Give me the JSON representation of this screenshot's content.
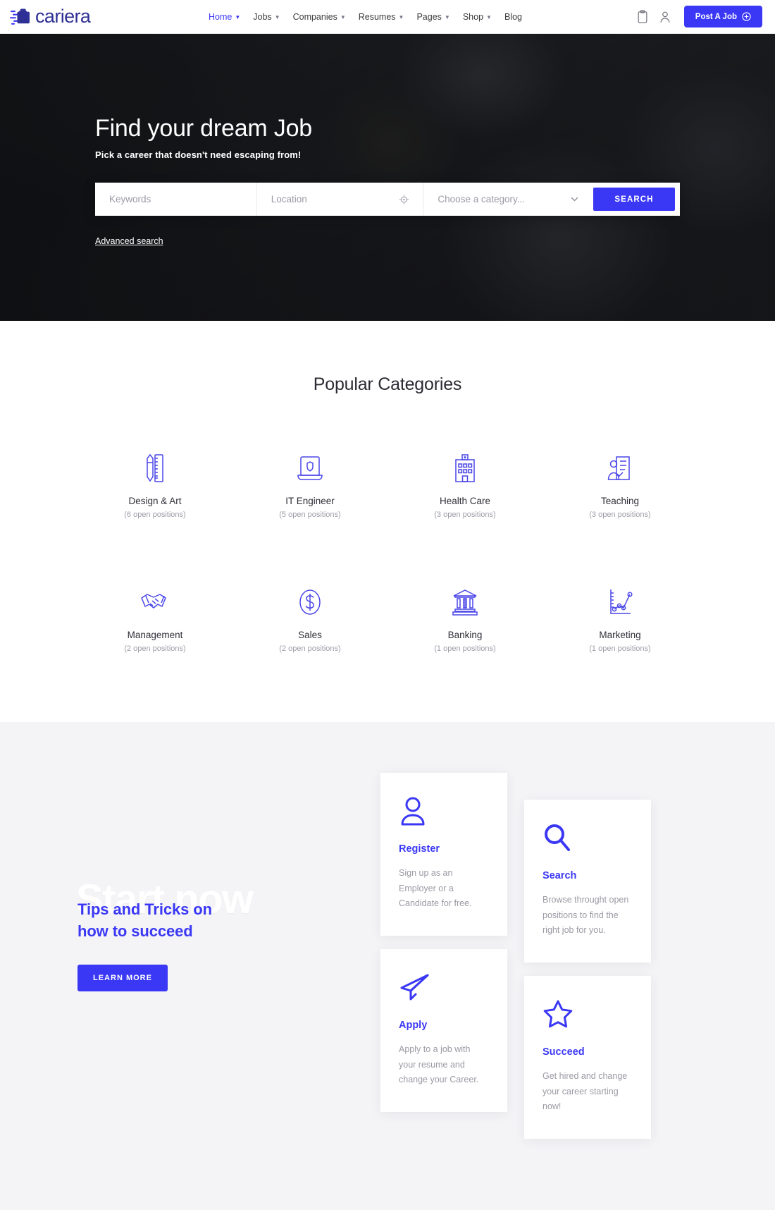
{
  "header": {
    "logo_text": "cariera",
    "logo_icon": "briefcase-speed-icon",
    "nav": [
      {
        "label": "Home",
        "has_caret": true,
        "active": true
      },
      {
        "label": "Jobs",
        "has_caret": true,
        "active": false
      },
      {
        "label": "Companies",
        "has_caret": true,
        "active": false
      },
      {
        "label": "Resumes",
        "has_caret": true,
        "active": false
      },
      {
        "label": "Pages",
        "has_caret": true,
        "active": false
      },
      {
        "label": "Shop",
        "has_caret": true,
        "active": false
      },
      {
        "label": "Blog",
        "has_caret": false,
        "active": false
      }
    ],
    "bookmark_icon": "clipboard-icon",
    "account_icon": "user-icon",
    "post_job_label": "Post A Job",
    "post_job_icon": "plus-circle-icon",
    "accent_color": "#3b38f5"
  },
  "hero": {
    "title": "Find your dream Job",
    "subtitle": "Pick a career that doesn't need escaping from!",
    "search": {
      "keywords_placeholder": "Keywords",
      "keywords_value": "",
      "location_placeholder": "Location",
      "location_value": "",
      "location_icon": "crosshair-icon",
      "category_value": "Choose a category...",
      "category_caret_icon": "chevron-down-icon",
      "search_button_label": "SEARCH"
    },
    "advanced_search_label": "Advanced search"
  },
  "categories": {
    "title": "Popular Categories",
    "items": [
      {
        "name": "Design & Art",
        "count": "(6 open positions)",
        "icon": "pen-ruler-icon"
      },
      {
        "name": "IT Engineer",
        "count": "(5 open positions)",
        "icon": "laptop-shield-icon"
      },
      {
        "name": "Health Care",
        "count": "(3 open positions)",
        "icon": "hospital-building-icon"
      },
      {
        "name": "Teaching",
        "count": "(3 open positions)",
        "icon": "teacher-board-icon"
      },
      {
        "name": "Management",
        "count": "(2 open positions)",
        "icon": "handshake-icon"
      },
      {
        "name": "Sales",
        "count": "(2 open positions)",
        "icon": "dollar-coin-icon"
      },
      {
        "name": "Banking",
        "count": "(1 open positions)",
        "icon": "bank-icon"
      },
      {
        "name": "Marketing",
        "count": "(1 open positions)",
        "icon": "growth-chart-icon"
      }
    ]
  },
  "start_now": {
    "watermark": "Start now",
    "heading": "Tips and Tricks on how to succeed",
    "heading_line1": "Tips and Tricks on",
    "heading_line2": "how to succeed",
    "learn_more_label": "LEARN MORE",
    "cards": [
      {
        "title": "Register",
        "desc": "Sign up as an Employer or a Candidate for free.",
        "icon": "user-icon"
      },
      {
        "title": "Search",
        "desc": "Browse throught open positions to find the right job for you.",
        "icon": "magnifier-icon"
      },
      {
        "title": "Apply",
        "desc": "Apply to a job with your resume and change your Career.",
        "icon": "paper-plane-icon"
      },
      {
        "title": "Succeed",
        "desc": "Get hired and change your career starting now!",
        "icon": "star-icon"
      }
    ]
  }
}
